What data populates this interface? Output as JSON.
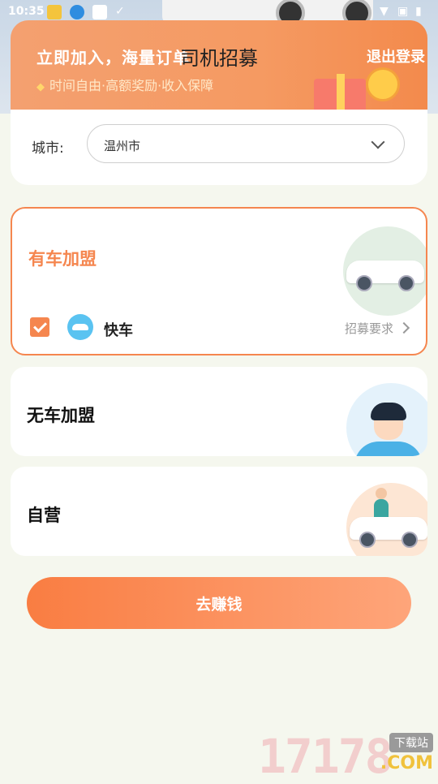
{
  "status_bar": {
    "time": "10:35"
  },
  "header": {
    "title": "司机招募",
    "logout_label": "退出登录",
    "banner_title": "立即加入，海量订单",
    "banner_subtitle": "时间自由·高额奖励·收入保障"
  },
  "city": {
    "label": "城市:",
    "value": "温州市"
  },
  "options": [
    {
      "title": "有车加盟",
      "selected": true,
      "service": {
        "name": "快车",
        "requirements_link": "招募要求"
      }
    },
    {
      "title": "无车加盟",
      "selected": false
    },
    {
      "title": "自营",
      "selected": false
    }
  ],
  "cta": {
    "label": "去赚钱"
  },
  "watermark": {
    "digits": "17178",
    "tag": "下载站",
    "suffix": ".COM"
  },
  "colors": {
    "accent": "#f5864f",
    "background": "#f5f7ee"
  }
}
